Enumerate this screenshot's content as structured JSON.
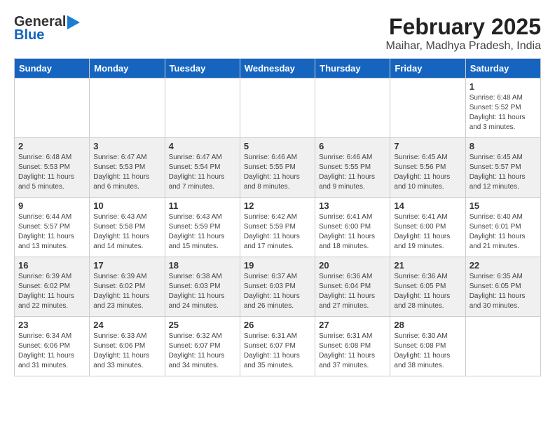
{
  "header": {
    "logo_line1": "General",
    "logo_line2": "Blue",
    "title": "February 2025",
    "subtitle": "Maihar, Madhya Pradesh, India"
  },
  "weekdays": [
    "Sunday",
    "Monday",
    "Tuesday",
    "Wednesday",
    "Thursday",
    "Friday",
    "Saturday"
  ],
  "weeks": [
    [
      {
        "day": "",
        "info": ""
      },
      {
        "day": "",
        "info": ""
      },
      {
        "day": "",
        "info": ""
      },
      {
        "day": "",
        "info": ""
      },
      {
        "day": "",
        "info": ""
      },
      {
        "day": "",
        "info": ""
      },
      {
        "day": "1",
        "info": "Sunrise: 6:48 AM\nSunset: 5:52 PM\nDaylight: 11 hours\nand 3 minutes."
      }
    ],
    [
      {
        "day": "2",
        "info": "Sunrise: 6:48 AM\nSunset: 5:53 PM\nDaylight: 11 hours\nand 5 minutes."
      },
      {
        "day": "3",
        "info": "Sunrise: 6:47 AM\nSunset: 5:53 PM\nDaylight: 11 hours\nand 6 minutes."
      },
      {
        "day": "4",
        "info": "Sunrise: 6:47 AM\nSunset: 5:54 PM\nDaylight: 11 hours\nand 7 minutes."
      },
      {
        "day": "5",
        "info": "Sunrise: 6:46 AM\nSunset: 5:55 PM\nDaylight: 11 hours\nand 8 minutes."
      },
      {
        "day": "6",
        "info": "Sunrise: 6:46 AM\nSunset: 5:55 PM\nDaylight: 11 hours\nand 9 minutes."
      },
      {
        "day": "7",
        "info": "Sunrise: 6:45 AM\nSunset: 5:56 PM\nDaylight: 11 hours\nand 10 minutes."
      },
      {
        "day": "8",
        "info": "Sunrise: 6:45 AM\nSunset: 5:57 PM\nDaylight: 11 hours\nand 12 minutes."
      }
    ],
    [
      {
        "day": "9",
        "info": "Sunrise: 6:44 AM\nSunset: 5:57 PM\nDaylight: 11 hours\nand 13 minutes."
      },
      {
        "day": "10",
        "info": "Sunrise: 6:43 AM\nSunset: 5:58 PM\nDaylight: 11 hours\nand 14 minutes."
      },
      {
        "day": "11",
        "info": "Sunrise: 6:43 AM\nSunset: 5:59 PM\nDaylight: 11 hours\nand 15 minutes."
      },
      {
        "day": "12",
        "info": "Sunrise: 6:42 AM\nSunset: 5:59 PM\nDaylight: 11 hours\nand 17 minutes."
      },
      {
        "day": "13",
        "info": "Sunrise: 6:41 AM\nSunset: 6:00 PM\nDaylight: 11 hours\nand 18 minutes."
      },
      {
        "day": "14",
        "info": "Sunrise: 6:41 AM\nSunset: 6:00 PM\nDaylight: 11 hours\nand 19 minutes."
      },
      {
        "day": "15",
        "info": "Sunrise: 6:40 AM\nSunset: 6:01 PM\nDaylight: 11 hours\nand 21 minutes."
      }
    ],
    [
      {
        "day": "16",
        "info": "Sunrise: 6:39 AM\nSunset: 6:02 PM\nDaylight: 11 hours\nand 22 minutes."
      },
      {
        "day": "17",
        "info": "Sunrise: 6:39 AM\nSunset: 6:02 PM\nDaylight: 11 hours\nand 23 minutes."
      },
      {
        "day": "18",
        "info": "Sunrise: 6:38 AM\nSunset: 6:03 PM\nDaylight: 11 hours\nand 24 minutes."
      },
      {
        "day": "19",
        "info": "Sunrise: 6:37 AM\nSunset: 6:03 PM\nDaylight: 11 hours\nand 26 minutes."
      },
      {
        "day": "20",
        "info": "Sunrise: 6:36 AM\nSunset: 6:04 PM\nDaylight: 11 hours\nand 27 minutes."
      },
      {
        "day": "21",
        "info": "Sunrise: 6:36 AM\nSunset: 6:05 PM\nDaylight: 11 hours\nand 28 minutes."
      },
      {
        "day": "22",
        "info": "Sunrise: 6:35 AM\nSunset: 6:05 PM\nDaylight: 11 hours\nand 30 minutes."
      }
    ],
    [
      {
        "day": "23",
        "info": "Sunrise: 6:34 AM\nSunset: 6:06 PM\nDaylight: 11 hours\nand 31 minutes."
      },
      {
        "day": "24",
        "info": "Sunrise: 6:33 AM\nSunset: 6:06 PM\nDaylight: 11 hours\nand 33 minutes."
      },
      {
        "day": "25",
        "info": "Sunrise: 6:32 AM\nSunset: 6:07 PM\nDaylight: 11 hours\nand 34 minutes."
      },
      {
        "day": "26",
        "info": "Sunrise: 6:31 AM\nSunset: 6:07 PM\nDaylight: 11 hours\nand 35 minutes."
      },
      {
        "day": "27",
        "info": "Sunrise: 6:31 AM\nSunset: 6:08 PM\nDaylight: 11 hours\nand 37 minutes."
      },
      {
        "day": "28",
        "info": "Sunrise: 6:30 AM\nSunset: 6:08 PM\nDaylight: 11 hours\nand 38 minutes."
      },
      {
        "day": "",
        "info": ""
      }
    ]
  ]
}
